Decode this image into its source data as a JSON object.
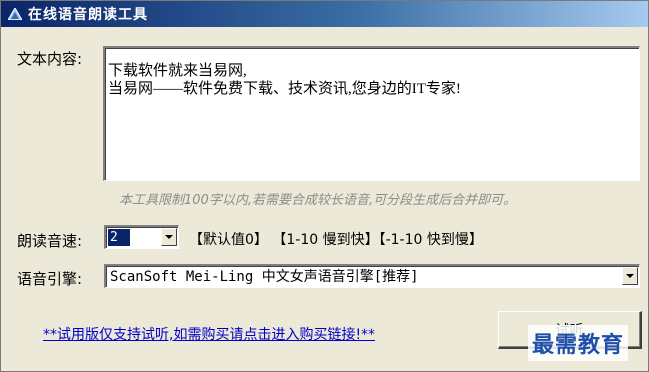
{
  "window": {
    "title": "在线语音朗读工具",
    "icon": "app-triangle-icon"
  },
  "text_section": {
    "label": "文本内容:",
    "content": "下载软件就来当易网,\n当易网——软件免费下载、技术资讯,您身边的IT专家!",
    "hint": "本工具限制100字以内,若需要合成较长语音,可分段生成后合并即可。"
  },
  "speed": {
    "label": "朗读音速:",
    "selected": "2",
    "hints": "【默认值0】 【1-10 慢到快】【-1-10 快到慢】"
  },
  "engine": {
    "label": "语音引擎:",
    "selected": "ScanSoft Mei-Ling 中文女声语音引擎[推荐]"
  },
  "footer": {
    "purchase_link": "**试用版仅支持试听,如需购买请点击进入购买链接!**",
    "button_label": "试听",
    "watermark": "最需教育"
  }
}
